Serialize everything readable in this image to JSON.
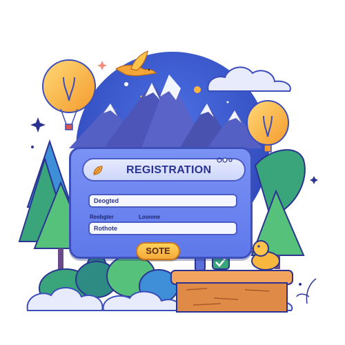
{
  "form": {
    "title": "REGISTRATION",
    "field1_value": "Deogted",
    "label_left": "Reebgter",
    "label_right": "Loonme",
    "field2_value": "Rothote",
    "button_label": "SOTE"
  },
  "colors": {
    "card": "#6b84f0",
    "card_border": "#3d4fb8",
    "sky": "#3c5cd6",
    "mountain": "#4d56b8",
    "snow": "#f2f4ff",
    "tree_green": "#3fa06a",
    "tree_teal": "#2e8b84",
    "balloon": "#ffb53d",
    "button": "#ffc24a",
    "wall": "#e08a48",
    "duck": "#f7b63d",
    "cloud": "#e7ebfb"
  },
  "icons": [
    "leaf-icon",
    "bird-icon",
    "cloud-icon",
    "balloon-icon",
    "sparkle-icon",
    "duck-icon",
    "checkmark-icon",
    "pipe-icon"
  ]
}
